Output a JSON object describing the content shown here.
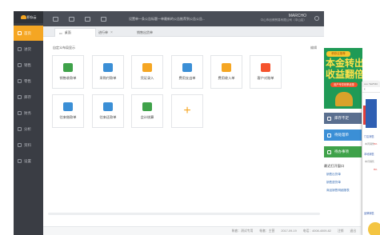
{
  "app": {
    "logo_text": "积存云"
  },
  "sidebar": {
    "items": [
      {
        "label": "首页",
        "active": true
      },
      {
        "label": "进货"
      },
      {
        "label": "销售"
      },
      {
        "label": "零售"
      },
      {
        "label": "库存"
      },
      {
        "label": "财务"
      },
      {
        "label": "分析"
      },
      {
        "label": "资料"
      },
      {
        "label": "设置"
      }
    ]
  },
  "header": {
    "notice": "设置单一条公告标题一单最新的公告推荐到公告公告...",
    "user_name": "MARCHO",
    "company": "中山市创博贸易有限公司（中山店）"
  },
  "tabs": [
    {
      "label": "桌面",
      "active": true
    },
    {
      "label": "进行单"
    },
    {
      "label": "销售出货单"
    }
  ],
  "main": {
    "section_title": "自定义布局显示",
    "edit_label": "编辑",
    "cards": [
      {
        "label": "销售收款单",
        "icon": "sales-receipt-icon",
        "color": "#3fa24a"
      },
      {
        "label": "采购付款单",
        "icon": "purchase-payment-icon",
        "color": "#3b8fd6"
      },
      {
        "label": "凭证录入",
        "icon": "voucher-icon",
        "color": "#f5a623"
      },
      {
        "label": "费用支出单",
        "icon": "expense-icon",
        "color": "#3b8fd6"
      },
      {
        "label": "费用收入单",
        "icon": "income-icon",
        "color": "#f5a623"
      },
      {
        "label": "客户对账单",
        "icon": "customer-statement-icon",
        "color": "#f5532d"
      },
      {
        "label": "往来借款单",
        "icon": "loan-icon",
        "color": "#3b8fd6"
      },
      {
        "label": "往来还款单",
        "icon": "repay-icon",
        "color": "#3b8fd6"
      },
      {
        "label": "会计核算",
        "icon": "calculator-icon",
        "color": "#3fa24a"
      }
    ]
  },
  "ad": {
    "badge": "积存云推荐",
    "line1": "本金转出",
    "line2": "收益翻倍",
    "pill": "用户专享利率优惠"
  },
  "quick_actions": [
    {
      "label": "库存不足",
      "color": "#5a6f8f"
    },
    {
      "label": "待处理单",
      "color": "#3b8fd6"
    },
    {
      "label": "待办事项",
      "color": "#3fa24a"
    }
  ],
  "recent": {
    "title": "最近打开窗口",
    "items": [
      "销售出货单",
      "销售退货单",
      "商品销售明细报表"
    ]
  },
  "status": {
    "texts": [
      "帐套：测试专用",
      "帐套：主营",
      "2017-09-19",
      "电话：4008-4009-82",
      "注销",
      "退出"
    ]
  },
  "phone": {
    "status": "••••• YesTxbt",
    "h1": "门店销售",
    "h2": "本地销售",
    "row1": "本周销售",
    "row2": "本月销售",
    "h3": "品牌销售",
    "red1": "5%",
    "red2": "8%"
  }
}
